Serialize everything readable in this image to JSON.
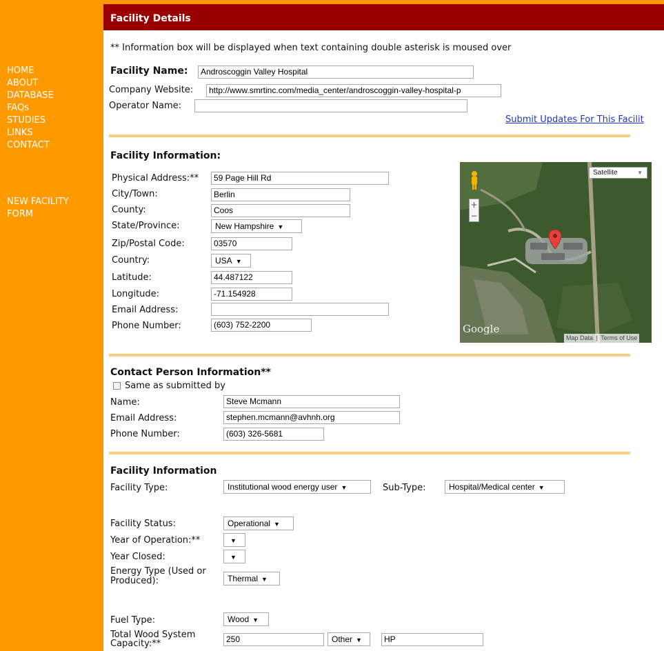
{
  "nav": {
    "items": [
      "HOME",
      "ABOUT",
      "DATABASE",
      "FAQs",
      "STUDIES",
      "LINKS",
      "CONTACT"
    ],
    "new_facility_line1": "NEW FACILITY",
    "new_facility_line2": "FORM"
  },
  "header": {
    "title": "Facility Details"
  },
  "info_note": "** Information box will be displayed when text containing double asterisk is moused over",
  "top": {
    "facility_name_label": "Facility Name:",
    "facility_name": "Androscoggin Valley Hospital",
    "website_label": "Company Website:",
    "website": "http://www.smrtinc.com/media_center/androscoggin-valley-hospital-p",
    "operator_label": "Operator Name:",
    "operator": "",
    "submit_link": "Submit Updates For This Facilit"
  },
  "location": {
    "heading": "Facility Information:",
    "address_label": "Physical Address:**",
    "address": "59 Page Hill Rd",
    "city_label": "City/Town:",
    "city": "Berlin",
    "county_label": "County:",
    "county": "Coos",
    "state_label": "State/Province:",
    "state": "New Hampshire",
    "zip_label": "Zip/Postal Code:",
    "zip": "03570",
    "country_label": "Country:",
    "country": "USA",
    "lat_label": "Latitude:",
    "lat": "44.487122",
    "lon_label": "Longitude:",
    "lon": "-71.154928",
    "email_label": "Email Address:",
    "email": "",
    "phone_label": "Phone Number:",
    "phone": "(603) 752-2200"
  },
  "map": {
    "type_button": "Satellite",
    "zoom_in": "+",
    "zoom_out": "−",
    "logo": "Google",
    "map_data": "Map Data",
    "terms": "Terms of Use",
    "colors": {
      "marker": "#e8413c",
      "forest": "#3c5a2d"
    }
  },
  "contact": {
    "heading": "Contact Person Information**",
    "same_as": "Same as submitted by",
    "name_label": "Name:",
    "name": "Steve Mcmann",
    "email_label": "Email Address:",
    "email": "stephen.mcmann@avhnh.org",
    "phone_label": "Phone Number:",
    "phone": "(603) 326-5681"
  },
  "facility": {
    "heading": "Facility Information",
    "type_label": "Facility Type:",
    "type": "Institutional wood energy user",
    "subtype_label": "Sub-Type:",
    "subtype": "Hospital/Medical center",
    "status_label": "Facility Status:",
    "status": "Operational",
    "year_op_label": "Year of Operation:**",
    "year_op": "",
    "year_closed_label": "Year Closed:",
    "year_closed": "",
    "energy_label_line1": "Energy Type (Used or",
    "energy_label_line2": "Produced):",
    "energy": "Thermal",
    "fuel_label": "Fuel Type:",
    "fuel": "Wood",
    "capacity_label_line1": "Total Wood System",
    "capacity_label_line2": "Capacity:**",
    "capacity": "250",
    "capacity_unit_select": "Other",
    "capacity_unit": "HP"
  },
  "colors": {
    "sidebar": "#ff9900",
    "header": "#990000",
    "separator": "#ffcc80",
    "link": "#2233cc"
  }
}
